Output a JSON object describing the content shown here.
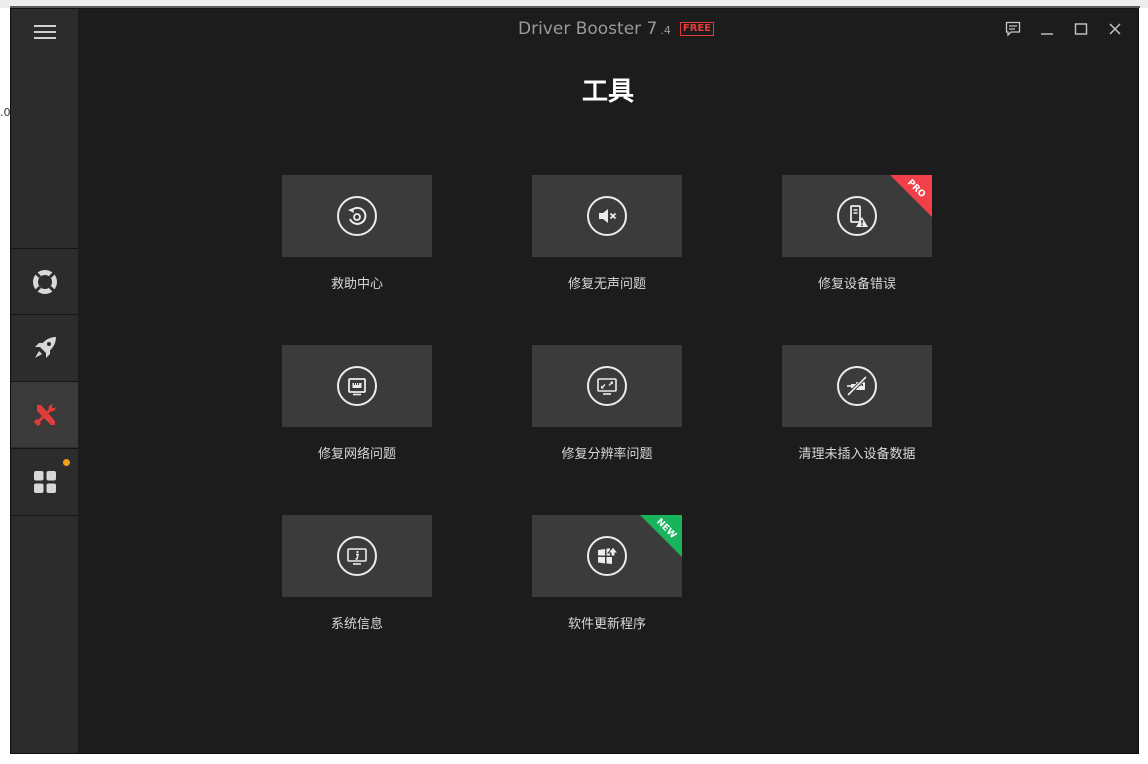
{
  "app": {
    "name": "Driver Booster 7",
    "version": ".4",
    "edition_badge": "FREE",
    "edge_text": ".0"
  },
  "page": {
    "title": "工具"
  },
  "sidebar": {
    "items": [
      {
        "icon": "lifebuoy-icon",
        "active": false
      },
      {
        "icon": "rocket-icon",
        "active": false
      },
      {
        "icon": "tools-icon",
        "active": true
      },
      {
        "icon": "apps-grid-icon",
        "active": false,
        "notification_dot": true
      }
    ]
  },
  "tools": [
    {
      "label": "救助中心",
      "icon": "restore-icon"
    },
    {
      "label": "修复无声问题",
      "icon": "speaker-mute-icon"
    },
    {
      "label": "修复设备错误",
      "icon": "device-warning-icon",
      "badge": "PRO"
    },
    {
      "label": "修复网络问题",
      "icon": "network-port-icon"
    },
    {
      "label": "修复分辨率问题",
      "icon": "monitor-resize-icon"
    },
    {
      "label": "清理未插入设备数据",
      "icon": "unplugged-device-icon"
    },
    {
      "label": "系统信息",
      "icon": "monitor-info-icon"
    },
    {
      "label": "软件更新程序",
      "icon": "software-update-icon",
      "badge": "NEW"
    }
  ],
  "colors": {
    "background": "#1c1c1c",
    "sidebar": "#2c2c2c",
    "tile": "#3b3b3b",
    "accent_red": "#e23b3b",
    "pro_ribbon": "#f2404a",
    "new_ribbon": "#18b35a",
    "notification": "#f0a020"
  }
}
